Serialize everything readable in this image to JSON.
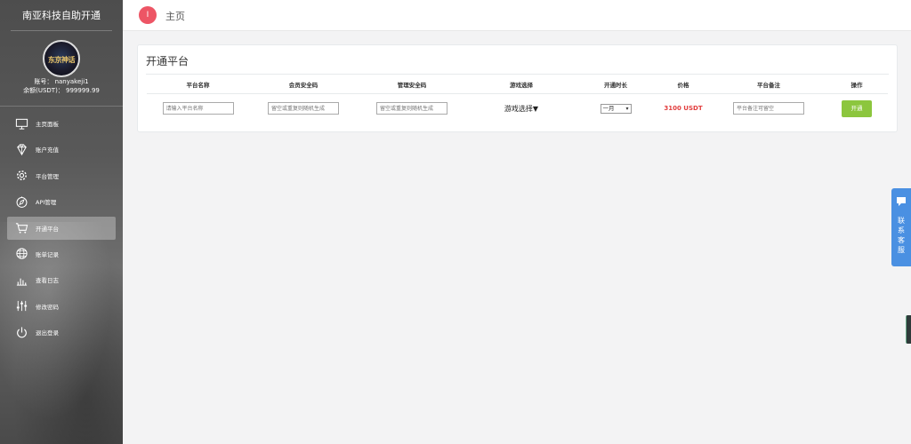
{
  "sidebar": {
    "brand": "南亚科技自助开通",
    "avatar_text": "东京神话",
    "account_line": "账号：  nanyakeji1",
    "balance_line": "余额(USDT)：  999999.99",
    "items": [
      {
        "label": "主页面板",
        "icon": "monitor-icon",
        "active": false
      },
      {
        "label": "账户充值",
        "icon": "diamond-icon",
        "active": false
      },
      {
        "label": "平台管理",
        "icon": "gear-icon",
        "active": false
      },
      {
        "label": "API管理",
        "icon": "compass-icon",
        "active": false
      },
      {
        "label": "开通平台",
        "icon": "cart-icon",
        "active": true
      },
      {
        "label": "账单记录",
        "icon": "globe-icon",
        "active": false
      },
      {
        "label": "查看日志",
        "icon": "bar-chart-icon",
        "active": false
      },
      {
        "label": "修改密码",
        "icon": "sliders-icon",
        "active": false
      },
      {
        "label": "退出登录",
        "icon": "power-icon",
        "active": false
      }
    ]
  },
  "topbar": {
    "dot_label": "I",
    "home_label": "主页"
  },
  "panel": {
    "title": "开通平台",
    "headers": [
      "平台名称",
      "会员安全码",
      "管理安全码",
      "游戏选择",
      "开通时长",
      "价格",
      "平台备注",
      "操作"
    ],
    "row": {
      "platform_placeholder": "请输入平台名称",
      "member_code_placeholder": "留空或重复则随机生成",
      "admin_code_placeholder": "留空或重复则随机生成",
      "game_select": "游戏选择▼",
      "duration": "一月",
      "price": "3100 USDT",
      "remark_placeholder": "平台备注可留空",
      "action_label": "开通"
    }
  },
  "service": {
    "label_chars": [
      "联",
      "系",
      "客",
      "服"
    ],
    "color": "#4a90e2"
  },
  "colors": {
    "accent_green": "#8cc63e",
    "price_red": "#e23e3e",
    "home_dot": "#ed5565"
  }
}
